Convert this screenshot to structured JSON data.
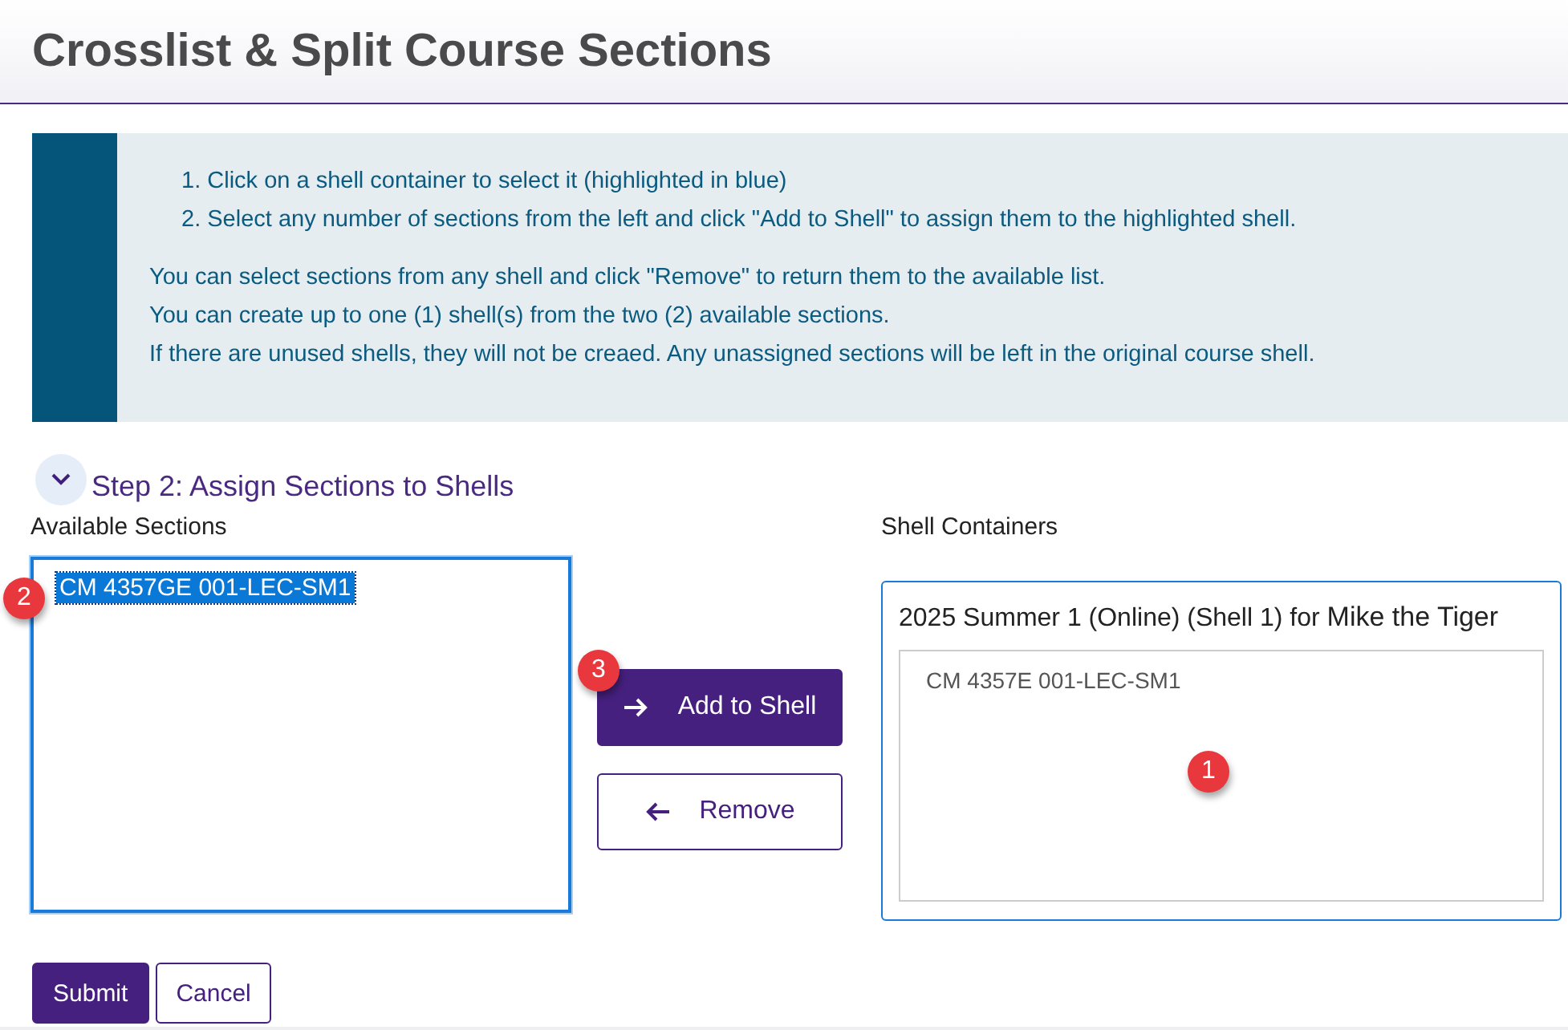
{
  "page_title": "Crosslist & Split Course Sections",
  "instructions": {
    "steps": [
      "1. Click on a shell container to select it (highlighted in blue)",
      "2. Select any number of sections from the left and click \"Add to Shell\" to assign them to the highlighted shell."
    ],
    "notes": [
      "You can select sections from any shell and click \"Remove\" to return them to the available list.",
      "You can create up to one (1) shell(s) from the two (2) available sections.",
      "If there are unused shells, they will not be creaed. Any unassigned sections will be left in the original course shell."
    ]
  },
  "step": {
    "title": "Step 2: Assign Sections to Shells",
    "expanded": true
  },
  "available": {
    "label": "Available Sections",
    "callout": "2",
    "items": [
      {
        "text": "CM 4357GE 001-LEC-SM1",
        "selected": true
      }
    ]
  },
  "actions": [
    {
      "label": "Add to Shell",
      "kind": "add",
      "callout": "3"
    },
    {
      "label": "Remove",
      "kind": "remove"
    }
  ],
  "shells": {
    "label": "Shell Containers",
    "items": [
      {
        "title": "2025 Summer 1 (Online) (Shell 1) for ",
        "owner": "Mike the Tiger",
        "selected": true,
        "callout": "1",
        "sections": [
          "CM 4357E 001-LEC-SM1"
        ]
      }
    ]
  },
  "form_buttons": [
    {
      "label": "Submit",
      "kind": "primary"
    },
    {
      "label": "Cancel",
      "kind": "secondary"
    }
  ]
}
